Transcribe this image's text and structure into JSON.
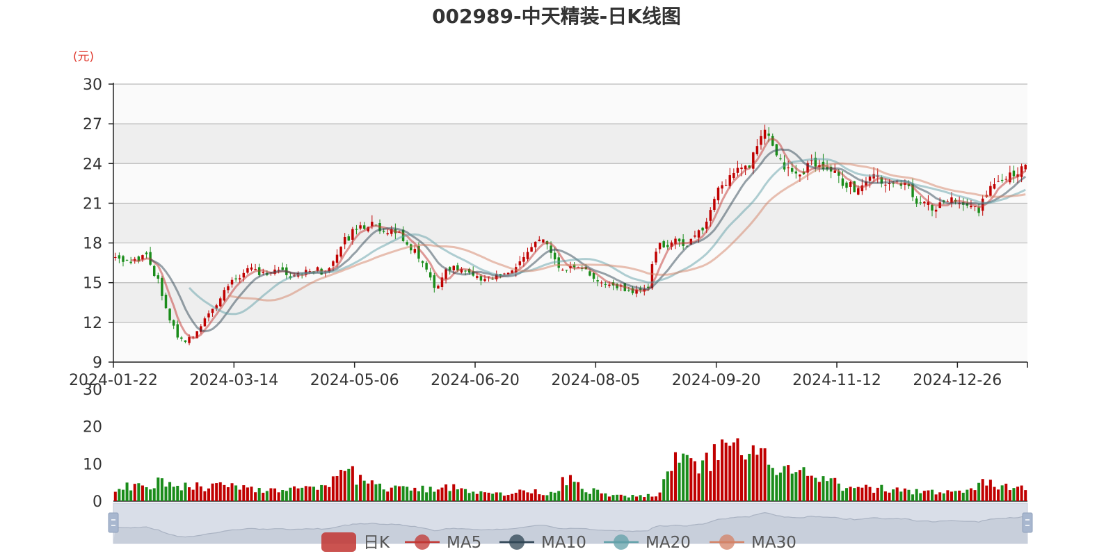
{
  "chart_data": {
    "type": "candlestick",
    "title": "002989-中天精装-日K线图",
    "price_unit": "(元)",
    "price_axis": {
      "min": 9,
      "max": 30,
      "ticks": [
        9,
        12,
        15,
        18,
        21,
        24,
        27,
        30
      ]
    },
    "volume_axis": {
      "min": 0,
      "max": 30,
      "ticks": [
        0,
        10,
        20,
        30
      ]
    },
    "x_tick_labels": [
      "2024-01-22",
      "2024-03-14",
      "2024-05-06",
      "2024-06-20",
      "2024-08-05",
      "2024-09-20",
      "2024-11-12",
      "2024-12-26"
    ],
    "x_tick_indices": [
      0,
      31,
      62,
      93,
      124,
      155,
      186,
      217
    ],
    "num_days": 235,
    "close_anchors": [
      [
        0,
        16.8
      ],
      [
        4,
        16.5
      ],
      [
        8,
        16.9
      ],
      [
        11,
        15.2
      ],
      [
        14,
        12.3
      ],
      [
        16,
        10.8
      ],
      [
        18,
        10.4
      ],
      [
        22,
        11.7
      ],
      [
        26,
        13.4
      ],
      [
        30,
        15.1
      ],
      [
        34,
        16.0
      ],
      [
        38,
        15.6
      ],
      [
        42,
        15.9
      ],
      [
        46,
        15.5
      ],
      [
        50,
        16.1
      ],
      [
        54,
        15.7
      ],
      [
        58,
        17.8
      ],
      [
        62,
        19.2
      ],
      [
        66,
        19.4
      ],
      [
        70,
        19.0
      ],
      [
        74,
        18.4
      ],
      [
        78,
        17.0
      ],
      [
        82,
        14.5
      ],
      [
        86,
        16.2
      ],
      [
        90,
        15.9
      ],
      [
        94,
        15.3
      ],
      [
        98,
        15.5
      ],
      [
        102,
        16.1
      ],
      [
        106,
        17.4
      ],
      [
        110,
        18.3
      ],
      [
        114,
        16.0
      ],
      [
        118,
        16.3
      ],
      [
        122,
        15.6
      ],
      [
        126,
        15.1
      ],
      [
        130,
        14.6
      ],
      [
        134,
        14.4
      ],
      [
        137,
        14.8
      ],
      [
        139,
        17.6
      ],
      [
        143,
        18.1
      ],
      [
        147,
        17.9
      ],
      [
        151,
        19.2
      ],
      [
        155,
        22.1
      ],
      [
        159,
        23.2
      ],
      [
        163,
        24.0
      ],
      [
        167,
        26.3
      ],
      [
        171,
        24.2
      ],
      [
        175,
        23.1
      ],
      [
        179,
        23.9
      ],
      [
        183,
        23.7
      ],
      [
        187,
        22.6
      ],
      [
        191,
        22.1
      ],
      [
        195,
        22.9
      ],
      [
        199,
        22.6
      ],
      [
        203,
        22.3
      ],
      [
        207,
        20.9
      ],
      [
        211,
        20.7
      ],
      [
        215,
        21.3
      ],
      [
        219,
        21.0
      ],
      [
        222,
        20.6
      ],
      [
        226,
        22.4
      ],
      [
        230,
        23.3
      ],
      [
        234,
        23.6
      ]
    ],
    "volume_anchors": [
      [
        0,
        3.6
      ],
      [
        6,
        3.8
      ],
      [
        12,
        5.0
      ],
      [
        18,
        4.2
      ],
      [
        24,
        3.9
      ],
      [
        30,
        4.5
      ],
      [
        36,
        3.2
      ],
      [
        44,
        3.3
      ],
      [
        50,
        3.0
      ],
      [
        55,
        3.4
      ],
      [
        58,
        8.6
      ],
      [
        61,
        7.0
      ],
      [
        66,
        4.6
      ],
      [
        72,
        3.2
      ],
      [
        78,
        3.1
      ],
      [
        84,
        3.6
      ],
      [
        88,
        4.6
      ],
      [
        92,
        2.1
      ],
      [
        100,
        2.0
      ],
      [
        106,
        2.6
      ],
      [
        112,
        2.2
      ],
      [
        117,
        7.0
      ],
      [
        121,
        3.2
      ],
      [
        127,
        1.4
      ],
      [
        134,
        1.3
      ],
      [
        140,
        1.8
      ],
      [
        143,
        11.0
      ],
      [
        147,
        9.5
      ],
      [
        150,
        8.5
      ],
      [
        153,
        11.2
      ],
      [
        156,
        13.5
      ],
      [
        159,
        12.8
      ],
      [
        162,
        12.5
      ],
      [
        166,
        11.2
      ],
      [
        170,
        10.0
      ],
      [
        173,
        8.2
      ],
      [
        177,
        6.8
      ],
      [
        181,
        5.4
      ],
      [
        185,
        4.6
      ],
      [
        190,
        3.0
      ],
      [
        196,
        3.5
      ],
      [
        202,
        2.8
      ],
      [
        208,
        2.7
      ],
      [
        214,
        2.4
      ],
      [
        218,
        2.3
      ],
      [
        222,
        4.5
      ],
      [
        227,
        4.2
      ],
      [
        231,
        3.6
      ],
      [
        234,
        3.8
      ]
    ],
    "series": [
      {
        "name": "日K",
        "color": "#c23531"
      },
      {
        "name": "MA5",
        "color": "#c23531",
        "window": 5
      },
      {
        "name": "MA10",
        "color": "#2f4554",
        "window": 10
      },
      {
        "name": "MA20",
        "color": "#61a0a8",
        "window": 20
      },
      {
        "name": "MA30",
        "color": "#d48265",
        "window": 30
      }
    ],
    "colors": {
      "up": "#c00000",
      "down": "#1a8c1a",
      "grid_band": "#eeeeee",
      "plot_bg": "#fafafa",
      "grid_line": "#bbbbbb",
      "axis_line": "#222222",
      "slider_bg": "#d9dee8",
      "slider_handle": "#a8b7cf"
    }
  }
}
